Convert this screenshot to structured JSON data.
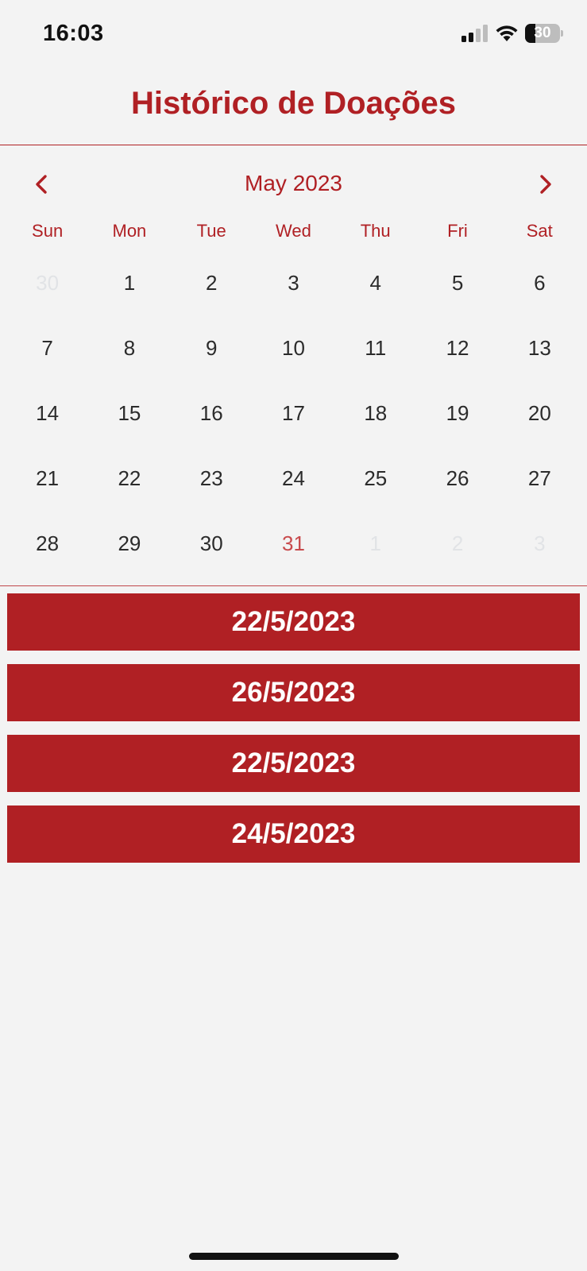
{
  "status_bar": {
    "time": "16:03",
    "battery_level": "30",
    "battery_fraction": 0.3,
    "icons": [
      "cellular-signal-icon",
      "wifi-icon",
      "battery-icon"
    ]
  },
  "header": {
    "title": "Histórico de Doações"
  },
  "calendar": {
    "month_label": "May 2023",
    "prev_icon": "chevron-left-icon",
    "next_icon": "chevron-right-icon",
    "weekdays": [
      "Sun",
      "Mon",
      "Tue",
      "Wed",
      "Thu",
      "Fri",
      "Sat"
    ],
    "days": [
      {
        "label": "30",
        "state": "outside"
      },
      {
        "label": "1",
        "state": "normal"
      },
      {
        "label": "2",
        "state": "normal"
      },
      {
        "label": "3",
        "state": "normal"
      },
      {
        "label": "4",
        "state": "normal"
      },
      {
        "label": "5",
        "state": "normal"
      },
      {
        "label": "6",
        "state": "normal"
      },
      {
        "label": "7",
        "state": "normal"
      },
      {
        "label": "8",
        "state": "normal"
      },
      {
        "label": "9",
        "state": "normal"
      },
      {
        "label": "10",
        "state": "normal"
      },
      {
        "label": "11",
        "state": "normal"
      },
      {
        "label": "12",
        "state": "normal"
      },
      {
        "label": "13",
        "state": "normal"
      },
      {
        "label": "14",
        "state": "normal"
      },
      {
        "label": "15",
        "state": "normal"
      },
      {
        "label": "16",
        "state": "normal"
      },
      {
        "label": "17",
        "state": "normal"
      },
      {
        "label": "18",
        "state": "normal"
      },
      {
        "label": "19",
        "state": "normal"
      },
      {
        "label": "20",
        "state": "normal"
      },
      {
        "label": "21",
        "state": "normal"
      },
      {
        "label": "22",
        "state": "normal"
      },
      {
        "label": "23",
        "state": "normal"
      },
      {
        "label": "24",
        "state": "normal"
      },
      {
        "label": "25",
        "state": "normal"
      },
      {
        "label": "26",
        "state": "normal"
      },
      {
        "label": "27",
        "state": "normal"
      },
      {
        "label": "28",
        "state": "normal"
      },
      {
        "label": "29",
        "state": "normal"
      },
      {
        "label": "30",
        "state": "normal"
      },
      {
        "label": "31",
        "state": "today"
      },
      {
        "label": "1",
        "state": "outside"
      },
      {
        "label": "2",
        "state": "outside"
      },
      {
        "label": "3",
        "state": "outside"
      }
    ]
  },
  "donations": [
    {
      "date": "22/5/2023"
    },
    {
      "date": "26/5/2023"
    },
    {
      "date": "22/5/2023"
    },
    {
      "date": "24/5/2023"
    }
  ],
  "colors": {
    "accent": "#b02024",
    "background": "#f3f3f3",
    "today": "#c84a4c",
    "outside_day": "#e1e3e6"
  }
}
